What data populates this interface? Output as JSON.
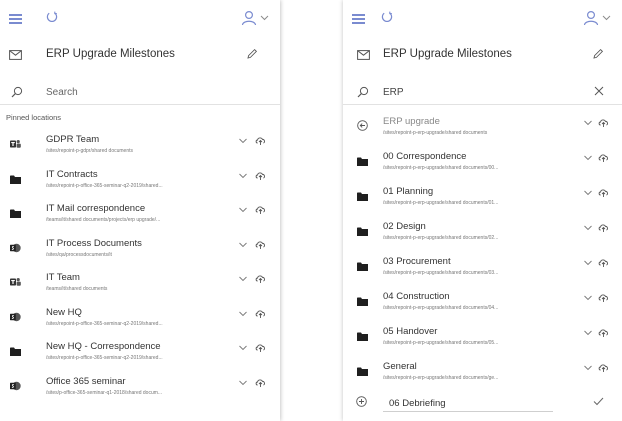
{
  "colors": {
    "accent": "#7a8bd0",
    "icon": "#555555",
    "folder": "#1f1f1f"
  },
  "left": {
    "title": "ERP Upgrade Milestones",
    "search_placeholder": "Search",
    "pinned_label": "Pinned locations",
    "items": [
      {
        "name": "GDPR Team",
        "path": "/sites/repoint-p-gdpr/shared documents",
        "icon": "teams-icon"
      },
      {
        "name": "IT Contracts",
        "path": "/sites/repoint-p-office-365-seminar-q2-2019/shared...",
        "icon": "folder-icon"
      },
      {
        "name": "IT Mail correspondence",
        "path": "/teams/it/shared documents/projects/erp upgrade/...",
        "icon": "folder-icon"
      },
      {
        "name": "IT Process Documents",
        "path": "/sites/qa/processdocuments/it",
        "icon": "sharepoint-icon"
      },
      {
        "name": "IT Team",
        "path": "/teams/it/shared documents",
        "icon": "teams-icon"
      },
      {
        "name": "New HQ",
        "path": "/sites/repoint-p-office-365-seminar-q2-2019/shared...",
        "icon": "sharepoint-icon"
      },
      {
        "name": "New HQ - Correspondence",
        "path": "/sites/repoint-p-office-365-seminar-q2-2019/shared...",
        "icon": "folder-icon"
      },
      {
        "name": "Office 365 seminar",
        "path": "/sites/p-office-365-seminar-q1-2018/shared docum...",
        "icon": "sharepoint-icon"
      }
    ]
  },
  "right": {
    "title": "ERP Upgrade Milestones",
    "search_value": "ERP",
    "items": [
      {
        "name": "ERP upgrade",
        "path": "/sites/repoint-p-erp-upgrade/shared documents",
        "icon": "back-arrow-icon"
      },
      {
        "name": "00 Correspondence",
        "path": "/sites/repoint-p-erp-upgrade/shared documents/00...",
        "icon": "folder-icon"
      },
      {
        "name": "01 Planning",
        "path": "/sites/repoint-p-erp-upgrade/shared documents/01...",
        "icon": "folder-icon"
      },
      {
        "name": "02 Design",
        "path": "/sites/repoint-p-erp-upgrade/shared documents/02...",
        "icon": "folder-icon"
      },
      {
        "name": "03 Procurement",
        "path": "/sites/repoint-p-erp-upgrade/shared documents/03...",
        "icon": "folder-icon"
      },
      {
        "name": "04 Construction",
        "path": "/sites/repoint-p-erp-upgrade/shared documents/04...",
        "icon": "folder-icon"
      },
      {
        "name": "05 Handover",
        "path": "/sites/repoint-p-erp-upgrade/shared documents/05...",
        "icon": "folder-icon"
      },
      {
        "name": "General",
        "path": "/sites/repoint-p-erp-upgrade/shared documents/ge...",
        "icon": "folder-icon"
      }
    ],
    "new_folder_value": "06 Debriefing"
  }
}
